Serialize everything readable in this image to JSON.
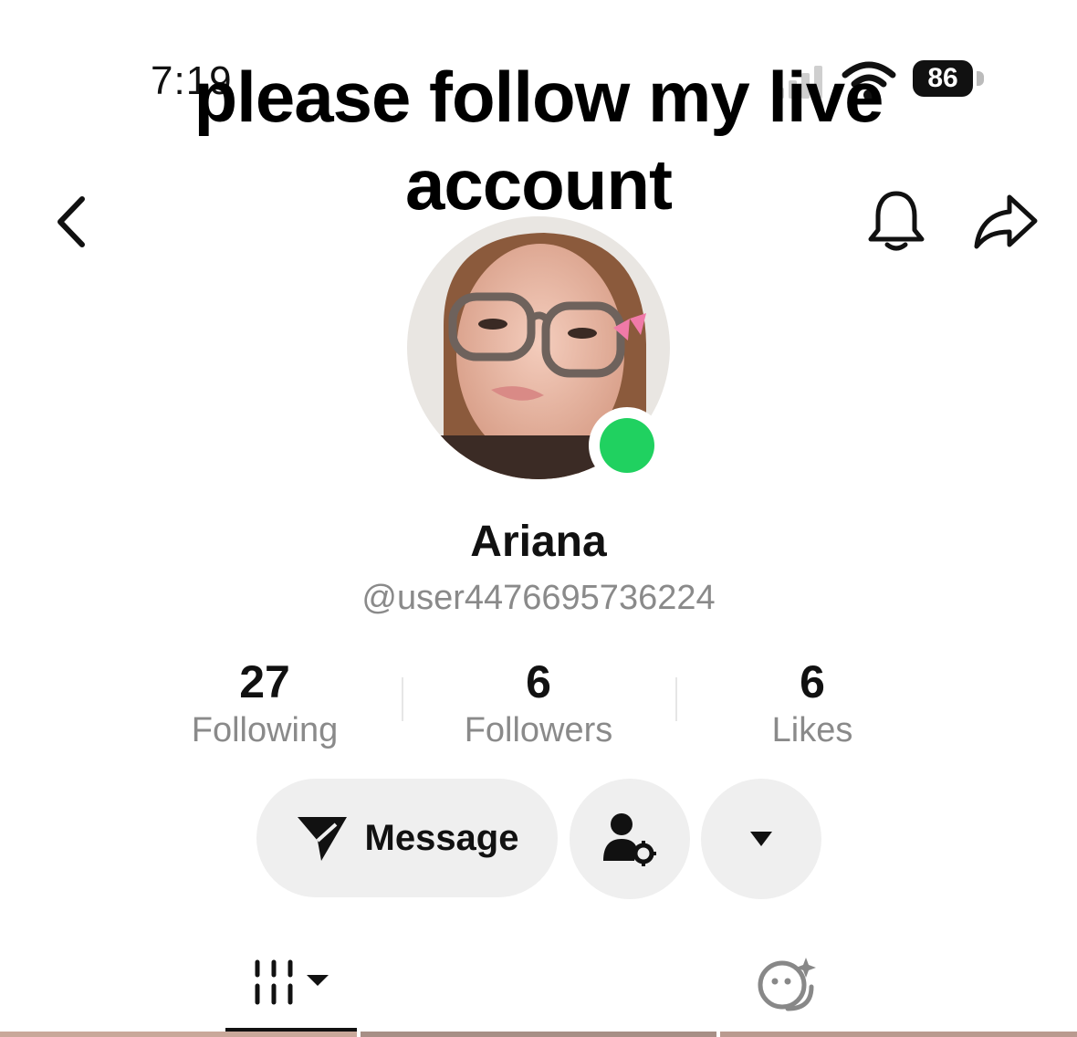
{
  "status_bar": {
    "time": "7:19",
    "battery_level": "86",
    "icons": [
      "cellular-signal-icon",
      "wifi-icon",
      "battery-icon"
    ]
  },
  "overlay": {
    "caption": "please follow my live account"
  },
  "nav": {
    "icons": [
      "back-chevron-icon",
      "bell-icon",
      "share-arrow-icon"
    ]
  },
  "profile": {
    "display_name": "Ariana",
    "username": "@user4476695736224",
    "live_indicator": true,
    "live_color": "#20d160"
  },
  "stats": [
    {
      "value": "27",
      "label": "Following"
    },
    {
      "value": "6",
      "label": "Followers"
    },
    {
      "value": "6",
      "label": "Likes"
    }
  ],
  "actions": {
    "message_label": "Message",
    "icons": [
      "send-icon",
      "user-settings-icon",
      "caret-down-icon"
    ]
  },
  "tabs": [
    {
      "name": "videos",
      "icon": "grid-lines-icon",
      "dropdown": true,
      "selected": true
    },
    {
      "name": "ai-self",
      "icon": "sparkle-face-icon",
      "selected": false
    }
  ],
  "colors": {
    "text": "#111111",
    "muted": "#8a8a8a",
    "button_bg": "#efefef",
    "live_green": "#20d160"
  }
}
